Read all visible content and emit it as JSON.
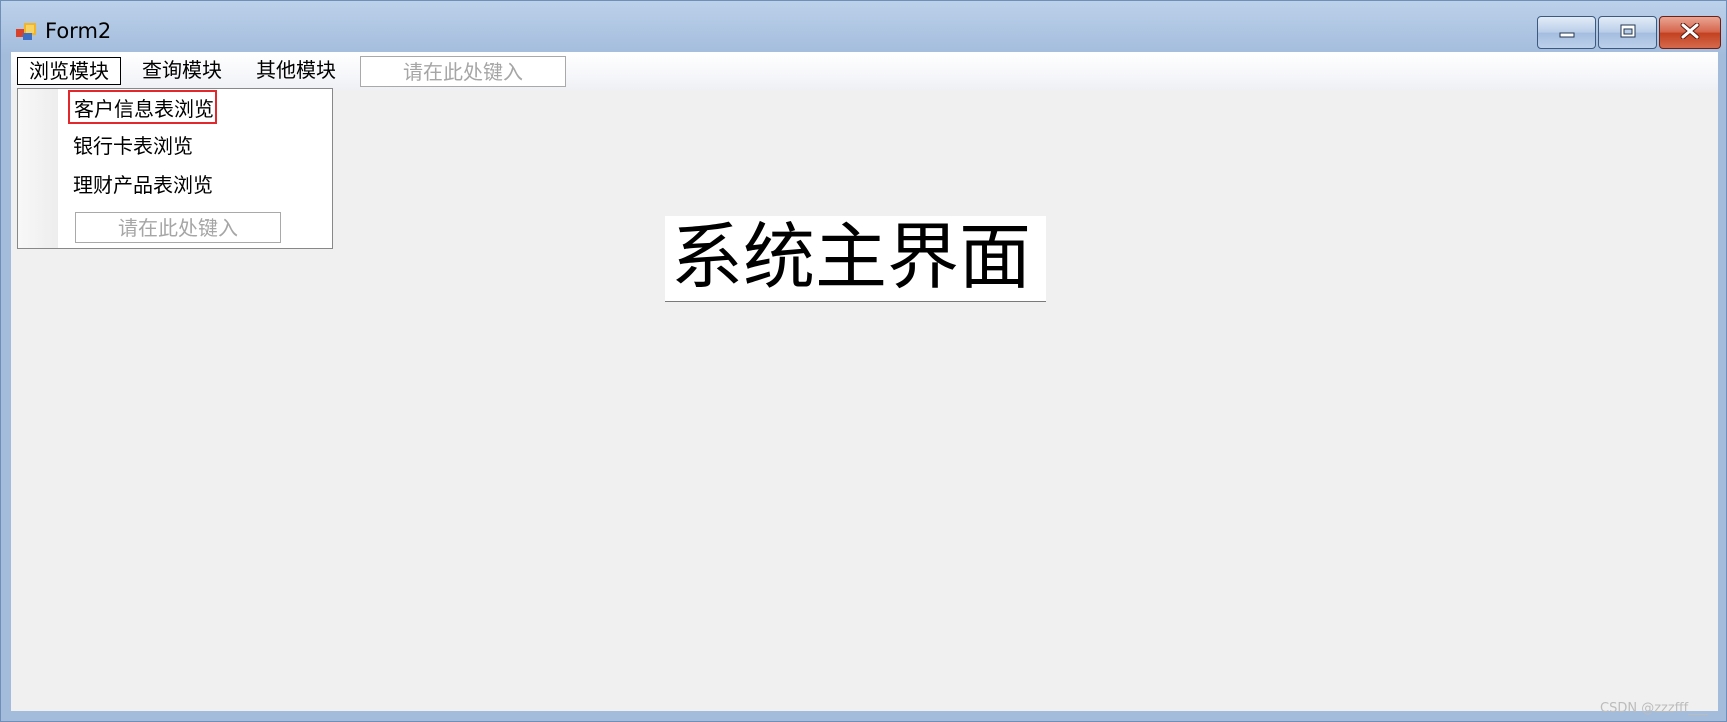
{
  "window": {
    "title": "Form2"
  },
  "menu": {
    "items": [
      {
        "label": "浏览模块"
      },
      {
        "label": "查询模块"
      },
      {
        "label": "其他模块"
      }
    ],
    "type_here_placeholder": "请在此处键入"
  },
  "dropdown": {
    "items": [
      {
        "label": "客户信息表浏览"
      },
      {
        "label": "银行卡表浏览"
      },
      {
        "label": "理财产品表浏览"
      }
    ],
    "type_here_placeholder": "请在此处键入",
    "highlight_color": "#e2282d"
  },
  "main": {
    "heading": "系统主界面"
  },
  "watermark": "CSDN @zzzfff___",
  "colors": {
    "titlebar": "#a3bcdc",
    "client_bg": "#f0f0f0",
    "close_button": "#c2401f"
  },
  "icons": {
    "app": "form-app-icon",
    "minimize": "minimize-icon",
    "maximize": "maximize-icon",
    "close": "close-icon"
  }
}
